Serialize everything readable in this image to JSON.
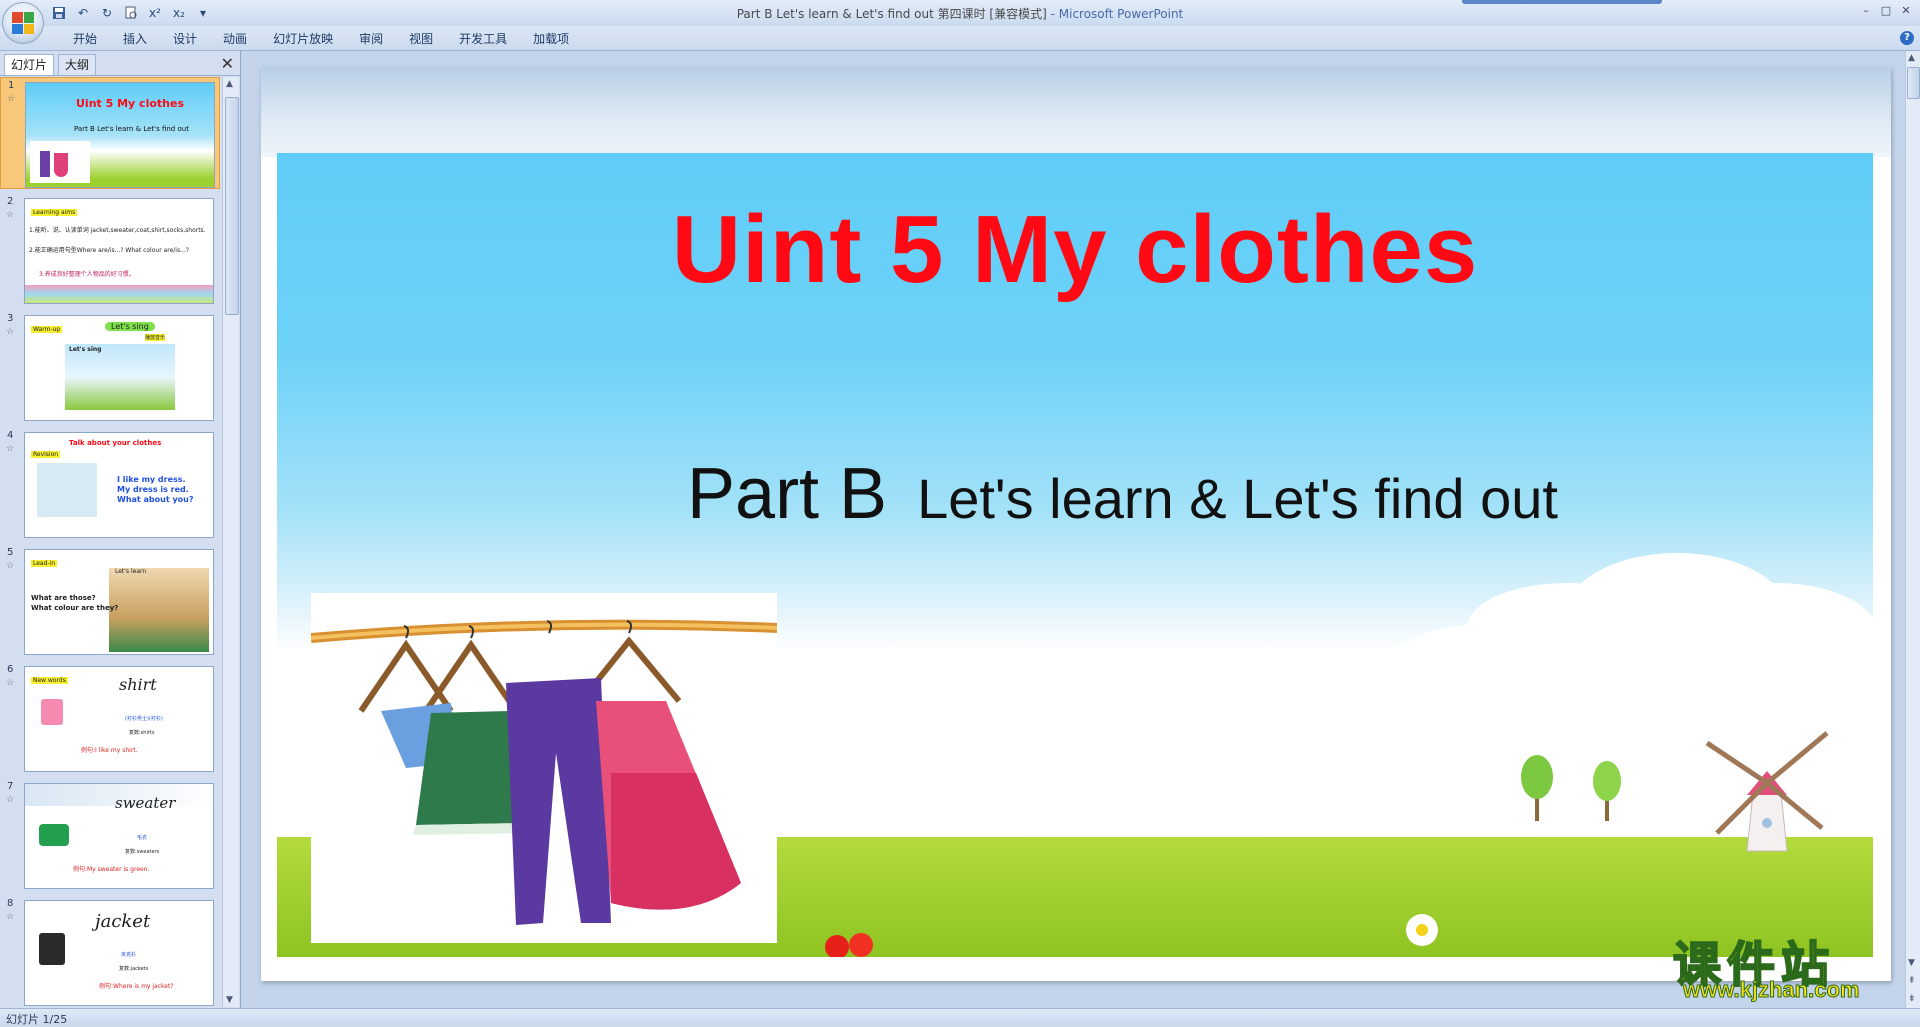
{
  "window": {
    "title": "Part B Let's learn & Let's find out 第四课时 [兼容模式]",
    "app_name": "- Microsoft PowerPoint",
    "controls": [
      "–",
      "□",
      "✕"
    ]
  },
  "ribbon": {
    "tabs": [
      "开始",
      "插入",
      "设计",
      "动画",
      "幻灯片放映",
      "审阅",
      "视图",
      "开发工具",
      "加载项"
    ]
  },
  "panel": {
    "tab_slides": "幻灯片",
    "tab_outline": "大纲",
    "close": "✕"
  },
  "thumbnails": [
    {
      "num": "1",
      "lines": [
        "Uint 5  My clothes",
        "Part B   Let's learn & Let's find out"
      ]
    },
    {
      "num": "2",
      "lines": [
        "Learning aims",
        "1.能听、说、认读单词 jacket,sweater,coat,shirt,socks,shorts.",
        "2.能正确运用句型Where  are/is...?  What colour  are/is...?",
        "3.养成良好整理个人物品的好习惯。"
      ]
    },
    {
      "num": "3",
      "lines": [
        "Warm-up",
        "Let's sing",
        "Let's sing",
        "播放音乐"
      ]
    },
    {
      "num": "4",
      "lines": [
        "Talk about your clothes",
        "Revision",
        "I like my dress.",
        "My dress is red.",
        "What about you?"
      ]
    },
    {
      "num": "5",
      "lines": [
        "Lead-in",
        "Let's learn",
        "What are those?",
        "What colour are they?"
      ]
    },
    {
      "num": "6",
      "lines": [
        "New words",
        "shirt",
        "(衬衫男士)(衬衫)",
        "复数:shirts",
        "例句:I like my shirt."
      ]
    },
    {
      "num": "7",
      "lines": [
        "sweater",
        "毛衣",
        "复数:sweaters",
        "例句:My sweater is green."
      ]
    },
    {
      "num": "8",
      "lines": [
        "jacket",
        "夹克衫",
        "复数:jackets",
        "例句:Where is my jacket?"
      ]
    }
  ],
  "slide": {
    "title": "Uint 5  My clothes",
    "part": "Part B",
    "subtitle": "Let's learn & Let's find out"
  },
  "status": {
    "slide_indicator": "幻灯片 1/25"
  },
  "watermark": {
    "text": "课件站",
    "url": "www.kjzhan.com"
  },
  "colors": {
    "title_red": "#ff0a14",
    "banner_blue": "#5fcdf8",
    "grass_green": "#9cd12f",
    "selected_thumb": "#f7c87a"
  }
}
